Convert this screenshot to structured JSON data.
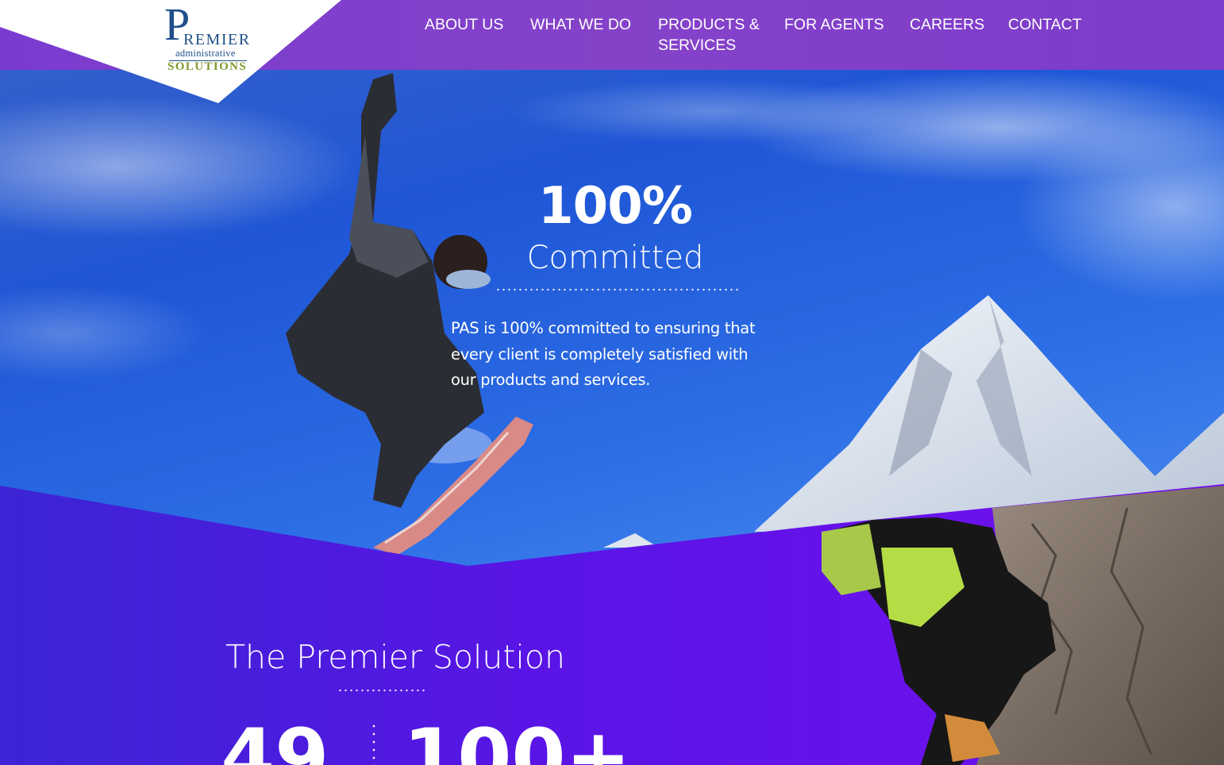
{
  "brand": {
    "logo_letter": "P",
    "logo_rest": "REMIER",
    "logo_sub": "administrative",
    "logo_bottom": "SOLUTIONS"
  },
  "nav": {
    "items": [
      {
        "label": "ABOUT US"
      },
      {
        "label": "WHAT WE DO"
      },
      {
        "label": "PRODUCTS & SERVICES"
      },
      {
        "label": "FOR AGENTS"
      },
      {
        "label": "CAREERS"
      },
      {
        "label": "CONTACT"
      }
    ]
  },
  "hero": {
    "stat": "100%",
    "stat_label": "Committed",
    "paragraph": "PAS is 100% committed to ensuring that every client is completely satisfied with our products and services."
  },
  "premier": {
    "title": "The Premier Solution",
    "stats": [
      "49",
      "100+"
    ]
  },
  "colors": {
    "header_purple": "#7f3fcc",
    "section_purple_left": "#3c22d6",
    "section_purple_right": "#7a10ee",
    "sky_blue": "#1f5fd8",
    "logo_blue": "#1f4f8a",
    "logo_green": "#7f9a2c"
  }
}
